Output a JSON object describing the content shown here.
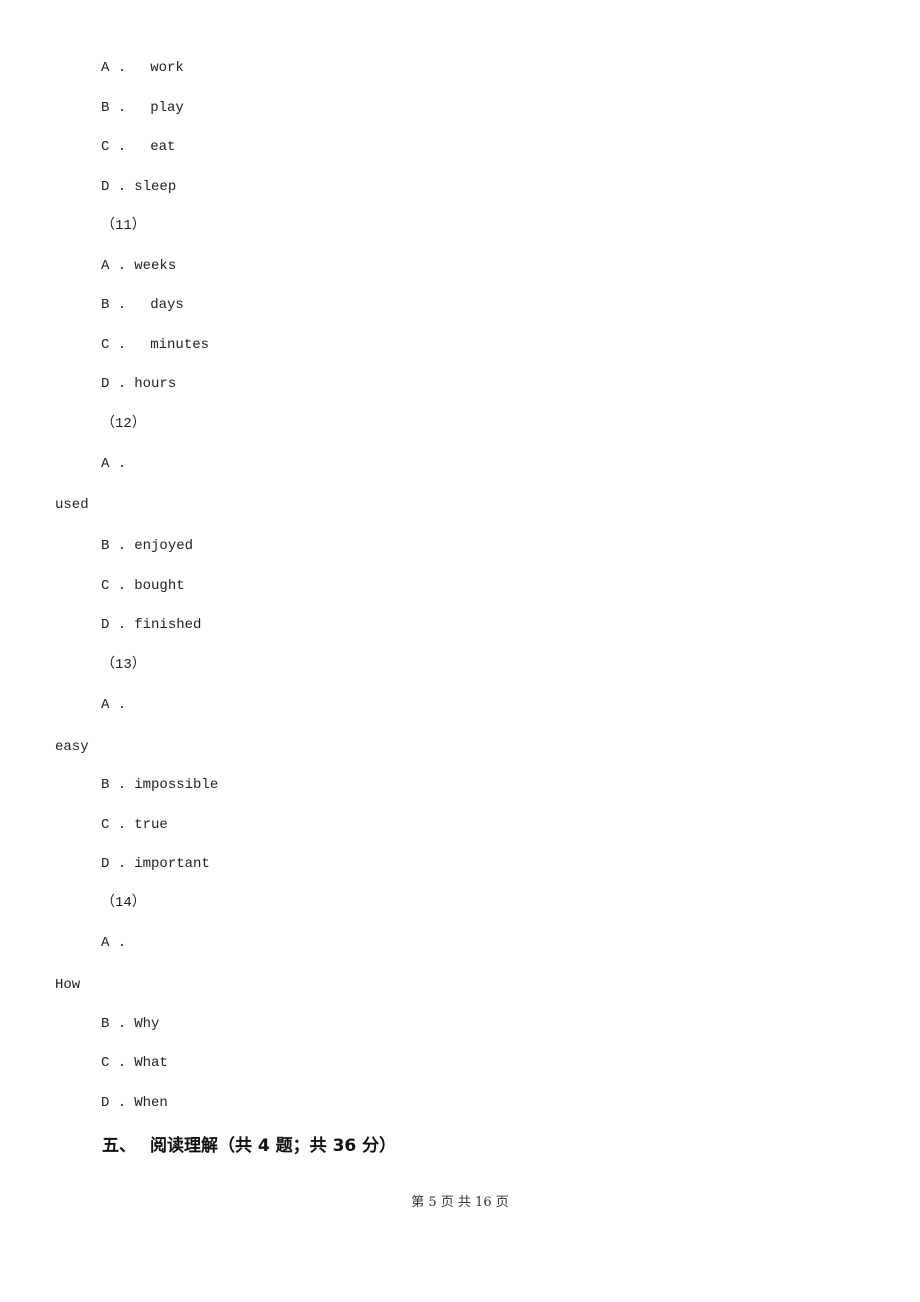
{
  "lines": [
    {
      "kind": "option",
      "label": "A .",
      "text": "work"
    },
    {
      "kind": "option",
      "label": "B .",
      "text": "play"
    },
    {
      "kind": "option",
      "label": "C .",
      "text": "eat"
    },
    {
      "kind": "option",
      "label": "D .",
      "text": "sleep"
    },
    {
      "kind": "qnum",
      "text": "（11）"
    },
    {
      "kind": "option",
      "label": "A .",
      "text": "weeks"
    },
    {
      "kind": "option",
      "label": "B .",
      "text": "days"
    },
    {
      "kind": "option",
      "label": "C .",
      "text": "minutes"
    },
    {
      "kind": "option",
      "label": "D .",
      "text": "hours"
    },
    {
      "kind": "qnum",
      "text": "（12）"
    },
    {
      "kind": "option",
      "label": "A .",
      "text": ""
    },
    {
      "kind": "wrap",
      "text": "used"
    },
    {
      "kind": "option",
      "label": "B .",
      "text": "enjoyed"
    },
    {
      "kind": "option",
      "label": "C .",
      "text": "bought"
    },
    {
      "kind": "option",
      "label": "D .",
      "text": "finished"
    },
    {
      "kind": "qnum",
      "text": "（13）"
    },
    {
      "kind": "option",
      "label": "A .",
      "text": ""
    },
    {
      "kind": "wrap",
      "text": "easy"
    },
    {
      "kind": "option",
      "label": "B .",
      "text": "impossible"
    },
    {
      "kind": "option",
      "label": "C .",
      "text": "true"
    },
    {
      "kind": "option",
      "label": "D .",
      "text": "important"
    },
    {
      "kind": "qnum",
      "text": "（14）"
    },
    {
      "kind": "option",
      "label": "A .",
      "text": ""
    },
    {
      "kind": "wrap",
      "text": "How"
    },
    {
      "kind": "option",
      "label": "B .",
      "text": "Why"
    },
    {
      "kind": "option",
      "label": "C .",
      "text": "What"
    },
    {
      "kind": "option",
      "label": "D .",
      "text": "When"
    }
  ],
  "section": {
    "number": "五、",
    "title": "阅读理解（共 4 题；共 36 分）"
  },
  "footer": "第 5 页 共 16 页"
}
